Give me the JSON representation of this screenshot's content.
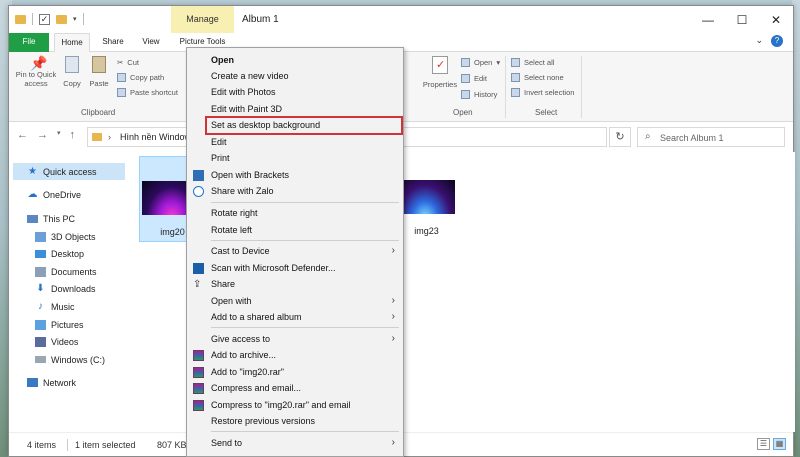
{
  "window": {
    "title": "Album 1",
    "context_tab": "Manage"
  },
  "window_buttons": {
    "minimize": "—",
    "maximize": "☐",
    "close": "✕"
  },
  "tabs": [
    "File",
    "Home",
    "Share",
    "View",
    "Picture Tools"
  ],
  "ribbon": {
    "clipboard": {
      "pin": "Pin to Quick access",
      "copy": "Copy",
      "paste": "Paste",
      "cut": "Cut",
      "copy_path": "Copy path",
      "paste_shortcut": "Paste shortcut",
      "group": "Clipboard"
    },
    "open_group": {
      "properties": "Properties",
      "open": "Open",
      "edit": "Edit",
      "history": "History",
      "group": "Open"
    },
    "select_group": {
      "select_all": "Select all",
      "select_none": "Select none",
      "invert": "Invert selection",
      "group": "Select"
    }
  },
  "address": {
    "path": "Hình nền Window",
    "search_placeholder": "Search Album 1"
  },
  "nav": [
    {
      "label": "Quick access",
      "icon": "star-icon"
    },
    {
      "label": "OneDrive",
      "icon": "cloud-icon"
    },
    {
      "label": "This PC",
      "icon": "computer-icon"
    },
    {
      "label": "3D Objects",
      "icon": "cube-icon"
    },
    {
      "label": "Desktop",
      "icon": "desktop-icon"
    },
    {
      "label": "Documents",
      "icon": "documents-icon"
    },
    {
      "label": "Downloads",
      "icon": "download-icon"
    },
    {
      "label": "Music",
      "icon": "music-icon"
    },
    {
      "label": "Pictures",
      "icon": "pictures-icon"
    },
    {
      "label": "Videos",
      "icon": "videos-icon"
    },
    {
      "label": "Windows (C:)",
      "icon": "drive-icon"
    },
    {
      "label": "Network",
      "icon": "network-icon"
    }
  ],
  "files": [
    {
      "name": "img20"
    },
    {
      "name": "img23"
    }
  ],
  "status": {
    "items": "4 items",
    "selected": "1 item selected",
    "size": "807 KB"
  },
  "context_menu": [
    {
      "label": "Open",
      "bold": true
    },
    {
      "label": "Create a new video"
    },
    {
      "label": "Edit with Photos"
    },
    {
      "label": "Edit with Paint 3D"
    },
    {
      "label": "Set as desktop background",
      "highlighted": true
    },
    {
      "label": "Edit"
    },
    {
      "label": "Print"
    },
    {
      "label": "Open with Brackets",
      "icon": "brackets-icon"
    },
    {
      "label": "Share with Zalo",
      "icon": "zalo-icon"
    },
    {
      "separator": true
    },
    {
      "label": "Rotate right"
    },
    {
      "label": "Rotate left"
    },
    {
      "separator": true
    },
    {
      "label": "Cast to Device",
      "submenu": true
    },
    {
      "label": "Scan with Microsoft Defender...",
      "icon": "defender-icon"
    },
    {
      "label": "Share",
      "icon": "share-icon"
    },
    {
      "label": "Open with",
      "submenu": true
    },
    {
      "label": "Add to a shared album",
      "submenu": true
    },
    {
      "separator": true
    },
    {
      "label": "Give access to",
      "submenu": true
    },
    {
      "label": "Add to archive...",
      "icon": "winrar-icon"
    },
    {
      "label": "Add to \"img20.rar\"",
      "icon": "winrar-icon"
    },
    {
      "label": "Compress and email...",
      "icon": "winrar-icon"
    },
    {
      "label": "Compress to \"img20.rar\" and email",
      "icon": "winrar-icon"
    },
    {
      "label": "Restore previous versions"
    },
    {
      "separator": true
    },
    {
      "label": "Send to",
      "submenu": true
    }
  ]
}
